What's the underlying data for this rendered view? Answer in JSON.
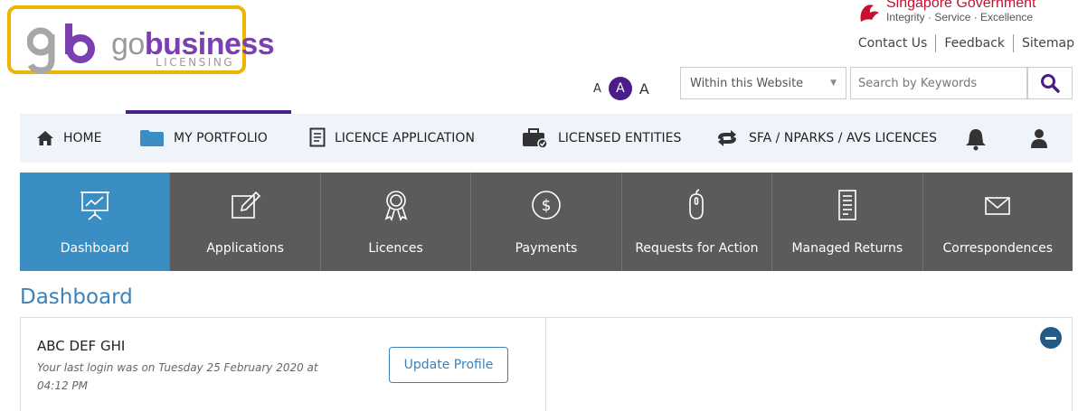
{
  "logo": {
    "go": "go",
    "business": "business",
    "sub": "LICENSING",
    "alt": "gobusiness licensing"
  },
  "gov": {
    "title": "Singapore Government",
    "tagline": "Integrity · Service · Excellence"
  },
  "top_links": [
    "Contact Us",
    "Feedback",
    "Sitemap"
  ],
  "font_size": {
    "small": "A",
    "medium": "A",
    "large": "A"
  },
  "search": {
    "scope": "Within this Website",
    "placeholder": "Search by Keywords"
  },
  "nav": [
    {
      "label": "HOME",
      "icon": "home-icon"
    },
    {
      "label": "MY PORTFOLIO",
      "icon": "folder-icon",
      "active": true
    },
    {
      "label": "LICENCE APPLICATION",
      "icon": "document-icon"
    },
    {
      "label": "LICENSED ENTITIES",
      "icon": "briefcase-icon"
    },
    {
      "label": "SFA / NPARKS / AVS LICENCES",
      "icon": "exchange-icon"
    }
  ],
  "tabs": [
    {
      "label": "Dashboard",
      "icon": "presentation-icon",
      "active": true
    },
    {
      "label": "Applications",
      "icon": "edit-icon"
    },
    {
      "label": "Licences",
      "icon": "award-icon"
    },
    {
      "label": "Payments",
      "icon": "dollar-icon"
    },
    {
      "label": "Requests for Action",
      "icon": "mouse-icon"
    },
    {
      "label": "Managed Returns",
      "icon": "report-icon"
    },
    {
      "label": "Correspondences",
      "icon": "envelope-icon"
    }
  ],
  "page_title": "Dashboard",
  "profile": {
    "name": "ABC DEF GHI",
    "last_login": "Your last login was on Tuesday 25 February 2020 at 04:12 PM",
    "update_label": "Update Profile"
  },
  "colors": {
    "brand_purple": "#4b1d8b",
    "accent_blue": "#3a8ec4",
    "logo_border": "#f0b400",
    "gov_red": "#c8102e",
    "tab_bg": "#5b5b5b"
  }
}
